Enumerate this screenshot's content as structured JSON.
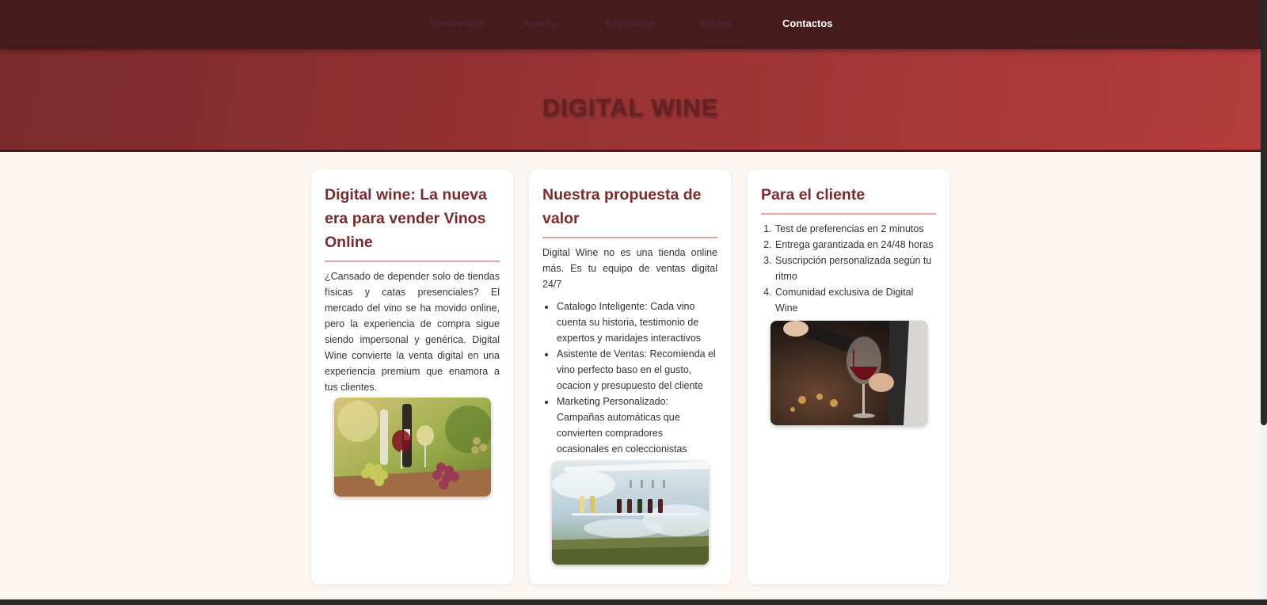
{
  "nav": {
    "items": [
      {
        "label": "Bienvenido"
      },
      {
        "label": "Acerca"
      },
      {
        "label": "Seguimos"
      },
      {
        "label": "Socios"
      },
      {
        "label": "Contactos"
      }
    ]
  },
  "hero": {
    "title": "DIGITAL WINE"
  },
  "cards": [
    {
      "title": "Digital wine: La nueva era para vender Vinos Online",
      "text": "¿Cansado de depender solo de tiendas físicas y catas presenciales? El mercado del vino se ha movido online, pero la experiencia de compra sigue siendo impersonal y genérica. Digital Wine convierte la venta digital en una experiencia premium que enamora a tus clientes."
    },
    {
      "title": "Nuestra propuesta de valor",
      "text": "Digital Wine no es una tienda online más. Es tu equipo de ventas digital 24/7",
      "bullets": [
        "Catalogo Inteligente: Cada vino cuenta su historia, testimonio de expertos y maridajes interactivos",
        "Asistente de Ventas: Recomienda el vino perfecto baso en el gusto, ocacion y presupuesto del cliente",
        "Marketing Personalizado: Campañas automáticas que convierten compradores ocasionales en coleccionistas"
      ]
    },
    {
      "title": "Para el cliente",
      "steps": [
        "Test de preferencias en 2 minutos",
        "Entrega garantizada en 24/48 horas",
        "Suscripción personalizada según tu ritmo",
        "Comunidad exclusiva de Digital Wine"
      ]
    }
  ],
  "icons": {
    "photo1": "wine-grapes-photo",
    "photo2": "wine-shelf-photo",
    "photo3": "wine-pouring-photo"
  },
  "colors": {
    "nav_bg": "#461b1b",
    "hero_start": "#7b2a2b",
    "hero_end": "#b43c3d",
    "accent": "#7a2b2c",
    "divider": "#e3a39f",
    "page_bg": "#fcf6f3"
  }
}
